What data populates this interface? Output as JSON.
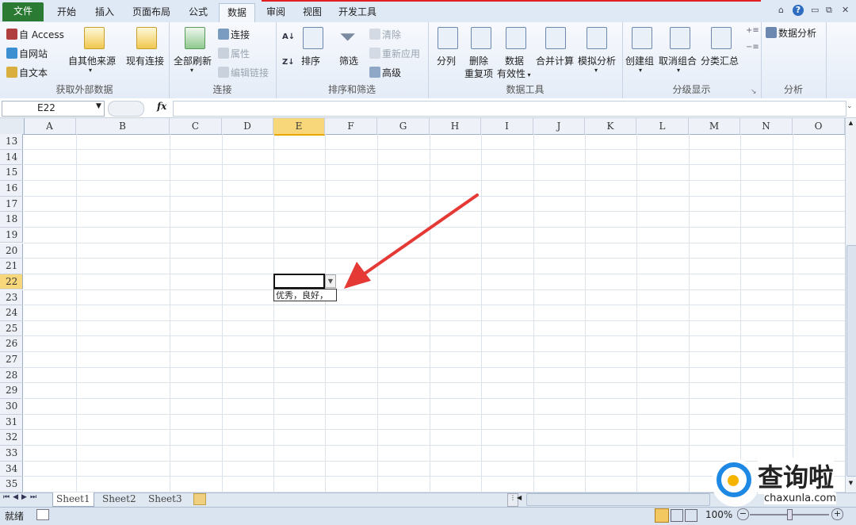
{
  "tabs": {
    "file": "文件",
    "home": "开始",
    "insert": "插入",
    "page_layout": "页面布局",
    "formulas": "公式",
    "data": "数据",
    "review": "审阅",
    "view": "视图",
    "developer": "开发工具"
  },
  "ribbon": {
    "get_external": {
      "from_access": "自 Access",
      "from_web": "自网站",
      "from_text": "自文本",
      "from_other": "自其他来源",
      "existing": "现有连接",
      "label": "获取外部数据"
    },
    "connections": {
      "refresh_all": "全部刷新",
      "connections": "连接",
      "properties": "属性",
      "edit_links": "编辑链接",
      "label": "连接"
    },
    "sort_filter": {
      "sort": "排序",
      "filter": "筛选",
      "clear": "清除",
      "reapply": "重新应用",
      "advanced": "高级",
      "label": "排序和筛选"
    },
    "data_tools": {
      "text_to_columns": "分列",
      "remove_dup_1": "删除",
      "remove_dup_2": "重复项",
      "validation_1": "数据",
      "validation_2": "有效性",
      "consolidate": "合并计算",
      "what_if": "模拟分析",
      "label": "数据工具"
    },
    "outline": {
      "group": "创建组",
      "ungroup": "取消组合",
      "subtotal": "分类汇总",
      "label": "分级显示"
    },
    "analysis": {
      "data_analysis": "数据分析",
      "label": "分析"
    }
  },
  "formula_bar": {
    "name_box": "E22",
    "fx": "fx",
    "value": ""
  },
  "columns": [
    "A",
    "B",
    "C",
    "D",
    "E",
    "F",
    "G",
    "H",
    "I",
    "J",
    "K",
    "L",
    "M",
    "N",
    "O"
  ],
  "rows": [
    "13",
    "14",
    "15",
    "16",
    "17",
    "18",
    "19",
    "20",
    "21",
    "22",
    "23",
    "24",
    "25",
    "26",
    "27",
    "28",
    "29",
    "30",
    "31",
    "32",
    "33",
    "34",
    "35"
  ],
  "selected": {
    "column": "E",
    "row": "22"
  },
  "dropdown": {
    "option": "优秀，良好，"
  },
  "sheets": [
    "Sheet1",
    "Sheet2",
    "Sheet3"
  ],
  "status": {
    "ready": "就绪",
    "zoom": "100%"
  },
  "watermark": {
    "brand": "查询啦",
    "url": "chaxunla.com"
  },
  "colors": {
    "accent": "#2a7a33",
    "selection": "#f7d77a",
    "arrow": "#e53935"
  }
}
